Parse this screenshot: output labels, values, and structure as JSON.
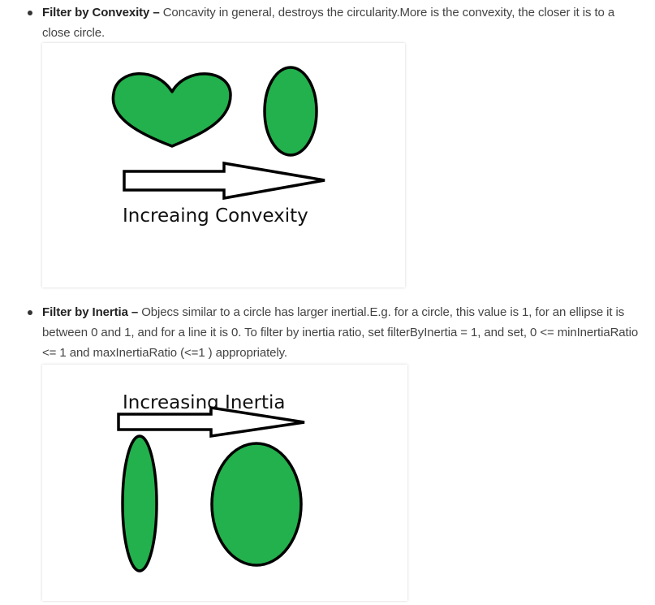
{
  "items": [
    {
      "term": "Filter by Convexity",
      "dash": " – ",
      "text": "Concavity in general, destroys the circularity.More is the convexity, the closer it is to a close circle."
    },
    {
      "term": "Filter by Inertia",
      "dash": " – ",
      "text": "Objecs similar to a circle has larger inertial.E.g. for a circle, this value is 1, for an ellipse it is between 0 and 1, and for a line it is 0. To filter by inertia ratio, set filterByInertia = 1, and set, 0 <= minInertiaRatio <= 1 and maxInertiaRatio (<=1 ) appropriately."
    }
  ],
  "figures": {
    "convexity": {
      "caption": "Increaing Convexity"
    },
    "inertia": {
      "caption": "Increasing Inertia"
    }
  },
  "colors": {
    "shape_fill": "#22b14c",
    "shape_stroke": "#000000"
  }
}
